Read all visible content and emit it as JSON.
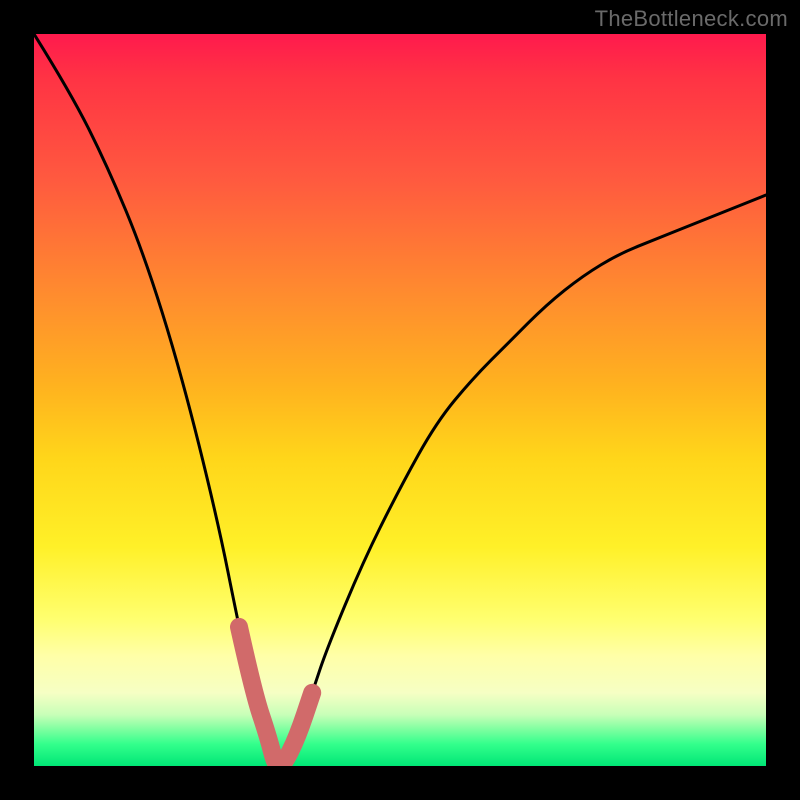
{
  "watermark": "TheBottleneck.com",
  "colors": {
    "page_bg": "#000000",
    "curve": "#000000",
    "highlight": "#d16a6a",
    "gradient_top": "#ff1a4d",
    "gradient_bottom": "#00e676"
  },
  "chart_data": {
    "type": "line",
    "title": "",
    "xlabel": "",
    "ylabel": "",
    "xlim": [
      0,
      100
    ],
    "ylim": [
      0,
      100
    ],
    "grid": false,
    "legend": false,
    "note": "Axes are not labeled in the rendered image. x/y scaled 0–100 across the visible plot area; y is read off the gradient (red≈100, green≈0). Curve is a V-shaped bottleneck profile with minimum ≈0 near x≈33.",
    "series": [
      {
        "name": "bottleneck-curve",
        "x": [
          0,
          5,
          10,
          15,
          20,
          25,
          28,
          30,
          32,
          33,
          34,
          36,
          38,
          40,
          45,
          50,
          55,
          60,
          65,
          70,
          75,
          80,
          85,
          90,
          95,
          100
        ],
        "y": [
          100,
          92,
          82,
          70,
          54,
          34,
          19,
          10,
          4,
          0,
          0,
          4,
          10,
          16,
          28,
          38,
          47,
          53,
          58,
          63,
          67,
          70,
          72,
          74,
          76,
          78
        ]
      }
    ],
    "highlight_segment": {
      "description": "Thick salmon overlay marking the near-zero bottleneck region around the curve minimum.",
      "x_range": [
        28,
        38
      ]
    }
  }
}
